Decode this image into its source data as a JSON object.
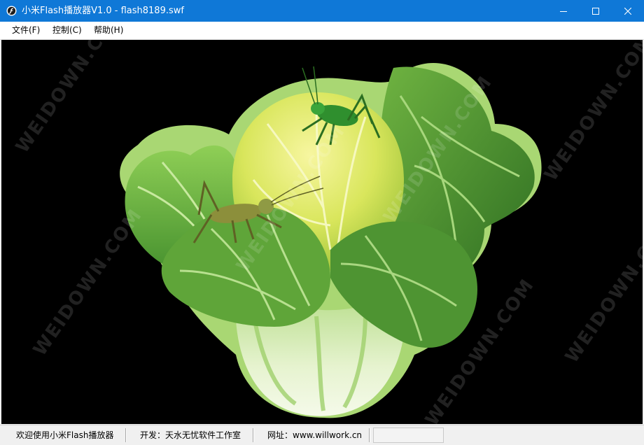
{
  "window": {
    "title": "小米Flash播放器V1.0 - flash8189.swf",
    "titlebar_color": "#0f78d7",
    "controls": {
      "minimize": "minimize-icon",
      "maximize": "maximize-icon",
      "close": "close-icon"
    }
  },
  "menu": {
    "items": [
      {
        "label": "文件(F)"
      },
      {
        "label": "控制(C)"
      },
      {
        "label": "帮助(H)"
      }
    ]
  },
  "stage": {
    "background": "#000000",
    "content": "cabbage-with-grasshoppers-illustration",
    "watermark": "WEIDOWN.COM"
  },
  "statusbar": {
    "welcome": "欢迎使用小米Flash播放器",
    "developer": "开发：天水无忧软件工作室",
    "website": "网址：www.willwork.cn",
    "extra": ""
  }
}
